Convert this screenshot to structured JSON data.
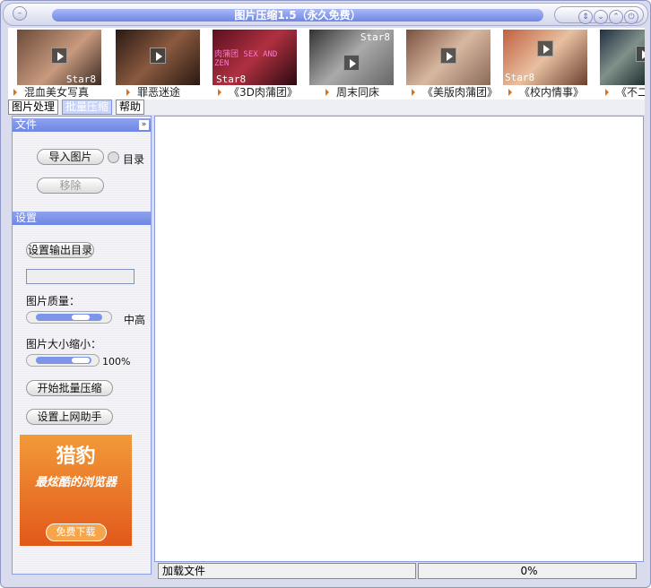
{
  "window": {
    "title": "图片压缩1.5（永久免费）",
    "buttons": [
      "minimize-button",
      "restore-button",
      "down-button",
      "up-button",
      "power-button"
    ]
  },
  "thumbnails": [
    {
      "label": "混血美女写真",
      "watermark": "Star8"
    },
    {
      "label": "罪恶迷途",
      "watermark": ""
    },
    {
      "label": "《3D肉蒲团》",
      "watermark": "Star8",
      "overlay": "肉蒲团 SEX AND ZEN"
    },
    {
      "label": "周末同床",
      "watermark": "Star8"
    },
    {
      "label": "《美版肉蒲团》",
      "watermark": ""
    },
    {
      "label": "《校内情事》",
      "watermark": "Star8"
    },
    {
      "label": "《不二",
      "watermark": ""
    }
  ],
  "tabs": [
    {
      "label": "图片处理"
    },
    {
      "label": "批量压缩",
      "active": true
    },
    {
      "label": "帮助"
    }
  ],
  "file_section": {
    "title": "文件",
    "import_button": "导入图片",
    "dir_radio": "目录",
    "remove_button": "移除"
  },
  "settings_section": {
    "title": "设置",
    "output_dir_button": "设置输出目录",
    "output_dir_value": "",
    "quality_label": "图片质量：",
    "quality_value": "中高",
    "quality_level": 0.75,
    "size_label": "图片大小缩小：",
    "size_value": "100%",
    "size_level": 1.0,
    "start_button": "开始批量压缩",
    "proxy_button": "设置上网助手"
  },
  "ad": {
    "brand": "猎豹",
    "slogan": "最炫酷的浏览器",
    "button": "免费下载"
  },
  "status": {
    "text": "加载文件",
    "progress": "0%"
  },
  "colors": {
    "accent": "#7c95ea",
    "ad": "#e9712a"
  }
}
